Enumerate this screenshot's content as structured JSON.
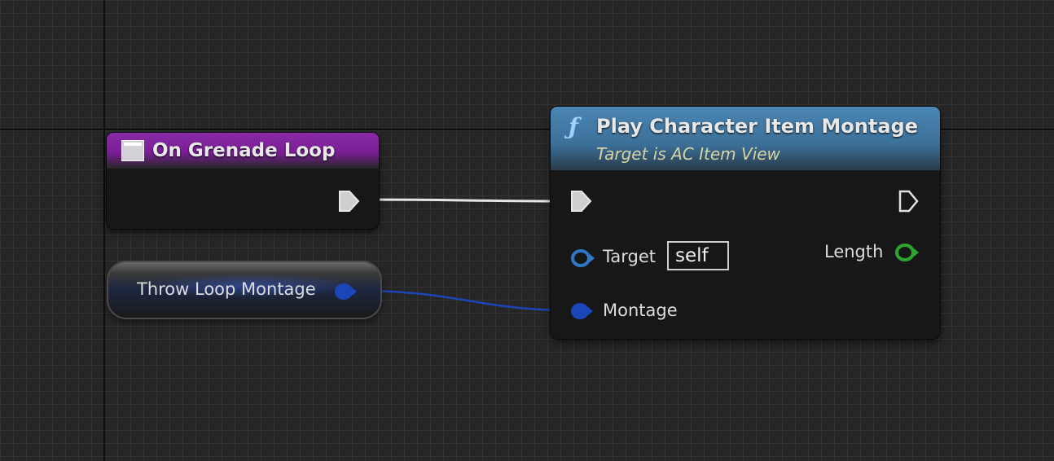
{
  "event_node": {
    "title": "On Grenade Loop",
    "icon": "event-icon",
    "color": "#7a1e96"
  },
  "variable_node": {
    "label": "Throw Loop Montage",
    "pin_color": "#1a46b8"
  },
  "function_node": {
    "icon": "function-f-icon",
    "title": "Play Character Item Montage",
    "subtitle": "Target is AC Item View",
    "header_color": "#3b6f98",
    "inputs": {
      "target_label": "Target",
      "target_value": "self",
      "montage_label": "Montage"
    },
    "outputs": {
      "length_label": "Length",
      "length_pin_color": "#2ea52e"
    }
  },
  "wires": {
    "exec_color": "#e6e6e6",
    "object_color": "#1a46b8"
  }
}
